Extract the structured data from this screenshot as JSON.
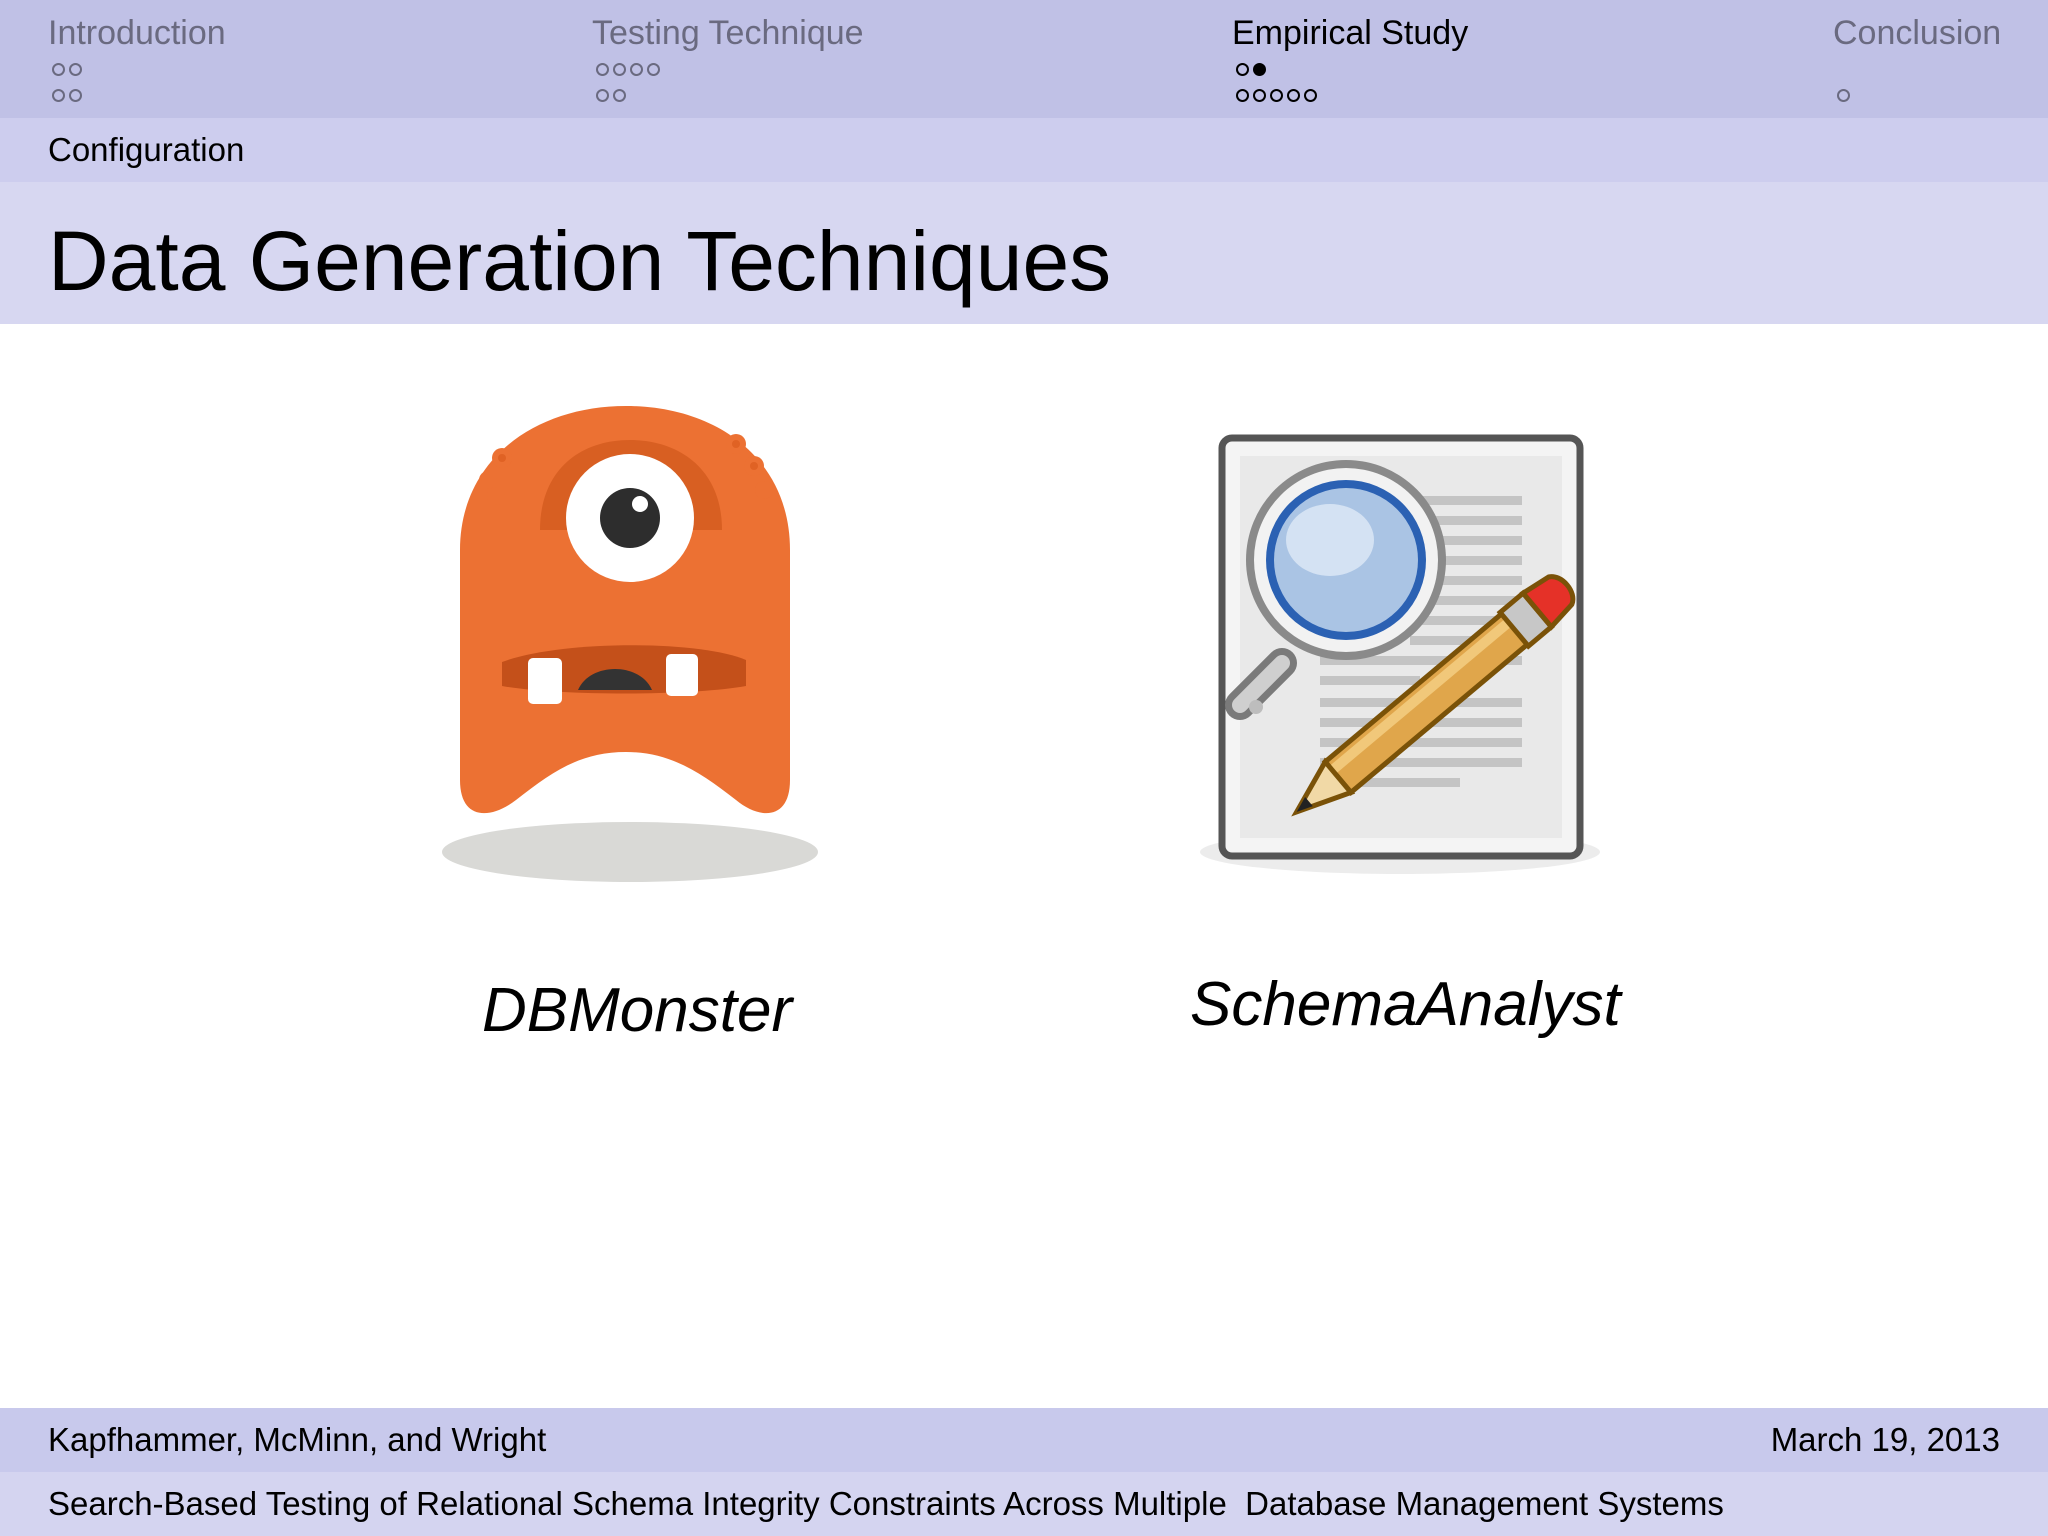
{
  "nav": {
    "sections": [
      {
        "title": "Introduction",
        "rows": [
          [
            0,
            0
          ],
          [
            0,
            0
          ]
        ]
      },
      {
        "title": "Testing Technique",
        "rows": [
          [
            0,
            0,
            0,
            0
          ],
          [
            0,
            0
          ]
        ]
      },
      {
        "title": "Empirical Study",
        "rows": [
          [
            0,
            1
          ],
          [
            0,
            0,
            0,
            0,
            0
          ]
        ],
        "active": true
      },
      {
        "title": "Conclusion",
        "rows": [
          [],
          [
            0
          ]
        ]
      }
    ]
  },
  "subsection": "Configuration",
  "title": "Data Generation Techniques",
  "figures": {
    "left_caption": "DBMonster",
    "right_caption": "SchemaAnalyst",
    "left_icon": "monster-mascot-icon",
    "right_icon": "document-magnifier-pencil-icon"
  },
  "footer": {
    "authors": "Kapfhammer, McMinn, and Wright",
    "date": "March 19, 2013",
    "talk_title": "Search-Based Testing of Relational Schema Integrity Constraints Across Multiple  Database Management Systems"
  },
  "colors": {
    "header_bg": "#c0c1e6",
    "subbar_bg": "#cdcdee",
    "titlebar_bg": "#d7d7f1",
    "monster_orange": "#ec7133"
  }
}
